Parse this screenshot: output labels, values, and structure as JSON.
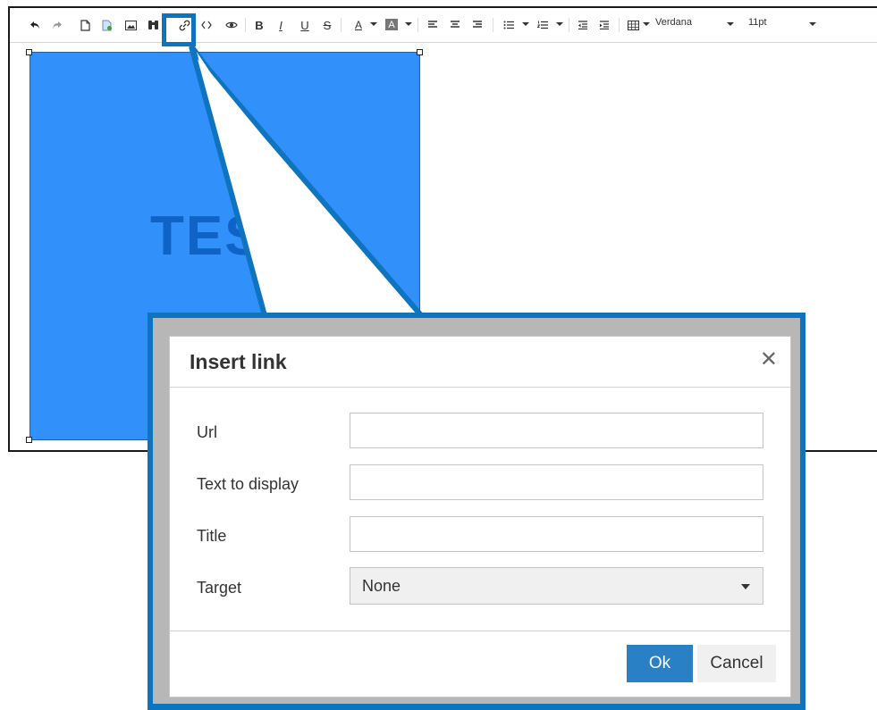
{
  "toolbar": {
    "font_family": "Verdana",
    "font_size": "11pt",
    "highlighted_button": "insert-link",
    "buttons": [
      "undo",
      "redo",
      "new-document",
      "insert-file",
      "insert-image",
      "find",
      "insert-link",
      "source-code",
      "preview",
      "bold",
      "italic",
      "underline",
      "strikethrough",
      "text-color",
      "background-color",
      "align-left",
      "align-center",
      "align-right",
      "bullet-list",
      "numbered-list",
      "outdent",
      "indent",
      "table"
    ]
  },
  "editor": {
    "image_text": "TES",
    "image_color": "#3290fb"
  },
  "dialog": {
    "title": "Insert link",
    "close_symbol": "✕",
    "fields": {
      "url_label": "Url",
      "url_value": "",
      "text_label": "Text to display",
      "text_value": "",
      "title_label": "Title",
      "title_value": "",
      "target_label": "Target",
      "target_value": "None"
    },
    "ok_label": "Ok",
    "cancel_label": "Cancel"
  },
  "colors": {
    "highlight": "#0f74c0",
    "ok_button": "#2a80c5",
    "image_fill": "#3290fb"
  }
}
